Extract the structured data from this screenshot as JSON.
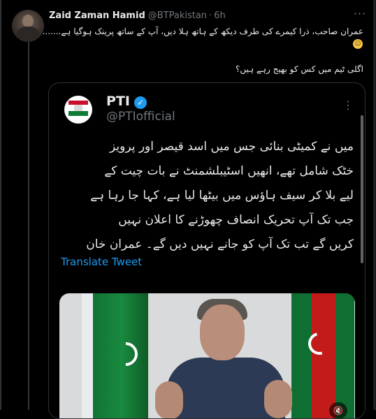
{
  "tweet": {
    "author_name": "Zaid Zaman Hamid",
    "author_handle": "@BTPakistan",
    "separator": "·",
    "time": "6h",
    "more_icon": "more-horizontal-icon",
    "text_line1": "عمران صاحب، ذرا کیمرے کی طرف دیکھ کے ہاتھ ہلا دیں، آپ کے ساتھ پرینک ہوگیا ہے.......",
    "emoji": "😁",
    "text_line2": "اگلی ٹیم میں کس کو بھیج رہے ہیں؟"
  },
  "quoted": {
    "name": "PTI",
    "handle": "@PTIofficial",
    "verified_icon": "verified-badge-icon",
    "text_lines": [
      "میں نے کمیٹی بنائی جس میں اسد قیصر اور پرویز",
      "خٹک شامل تھے، انھیں اسٹیبلشمنٹ نے بات چیت کے",
      "لیے بلا کر سیف ہاؤس میں بیٹھا لیا ہے، کہا جا رہا ہے",
      "جب تک آپ تحریک انصاف چھوڑنے کا اعلان نہیں",
      "کریں گے تب تک آپ کو جانے نہیں دیں گے۔ عمران خان"
    ],
    "translate_label": "Translate Tweet"
  },
  "colors": {
    "background": "#000000",
    "text": "#e7e9ea",
    "muted": "#71767b",
    "accent": "#1d9bf0"
  }
}
